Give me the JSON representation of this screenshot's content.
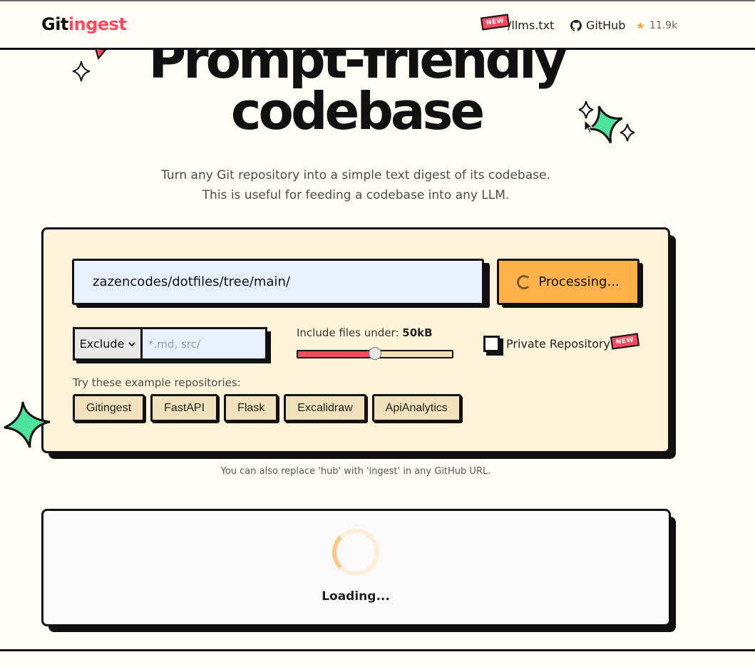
{
  "header": {
    "logo_part1": "Git",
    "logo_part2": "ingest",
    "llms_badge": "NEW",
    "llms_label": "/llms.txt",
    "github_label": "GitHub",
    "github_stars": "11.9k"
  },
  "hero": {
    "title_line1": "Prompt-friendly",
    "title_line2": "codebase",
    "subtitle_line1": "Turn any Git repository into a simple text digest of its codebase.",
    "subtitle_line2": "This is useful for feeding a codebase into any LLM."
  },
  "form": {
    "url_value": "zazencodes/dotfiles/tree/main/",
    "submit_label": "Processing...",
    "filter_mode": "Exclude",
    "filter_placeholder": "*.md, src/",
    "size_label": "Include files under: ",
    "size_value": "50kB",
    "size_fraction": 0.5,
    "private_label": "Private Repository",
    "private_badge": "NEW",
    "private_checked": false,
    "examples_label": "Try these example repositories:",
    "examples": [
      "Gitingest",
      "FastAPI",
      "Flask",
      "Excalidraw",
      "ApiAnalytics"
    ]
  },
  "note": "You can also replace 'hub' with 'ingest' in any GitHub URL.",
  "loading": {
    "text": "Loading..."
  },
  "colors": {
    "accent": "#fe4a60",
    "button": "#ffb14a",
    "card": "#fff4da",
    "sparkle_green": "#4ee39a",
    "background": "#fffdf6"
  }
}
